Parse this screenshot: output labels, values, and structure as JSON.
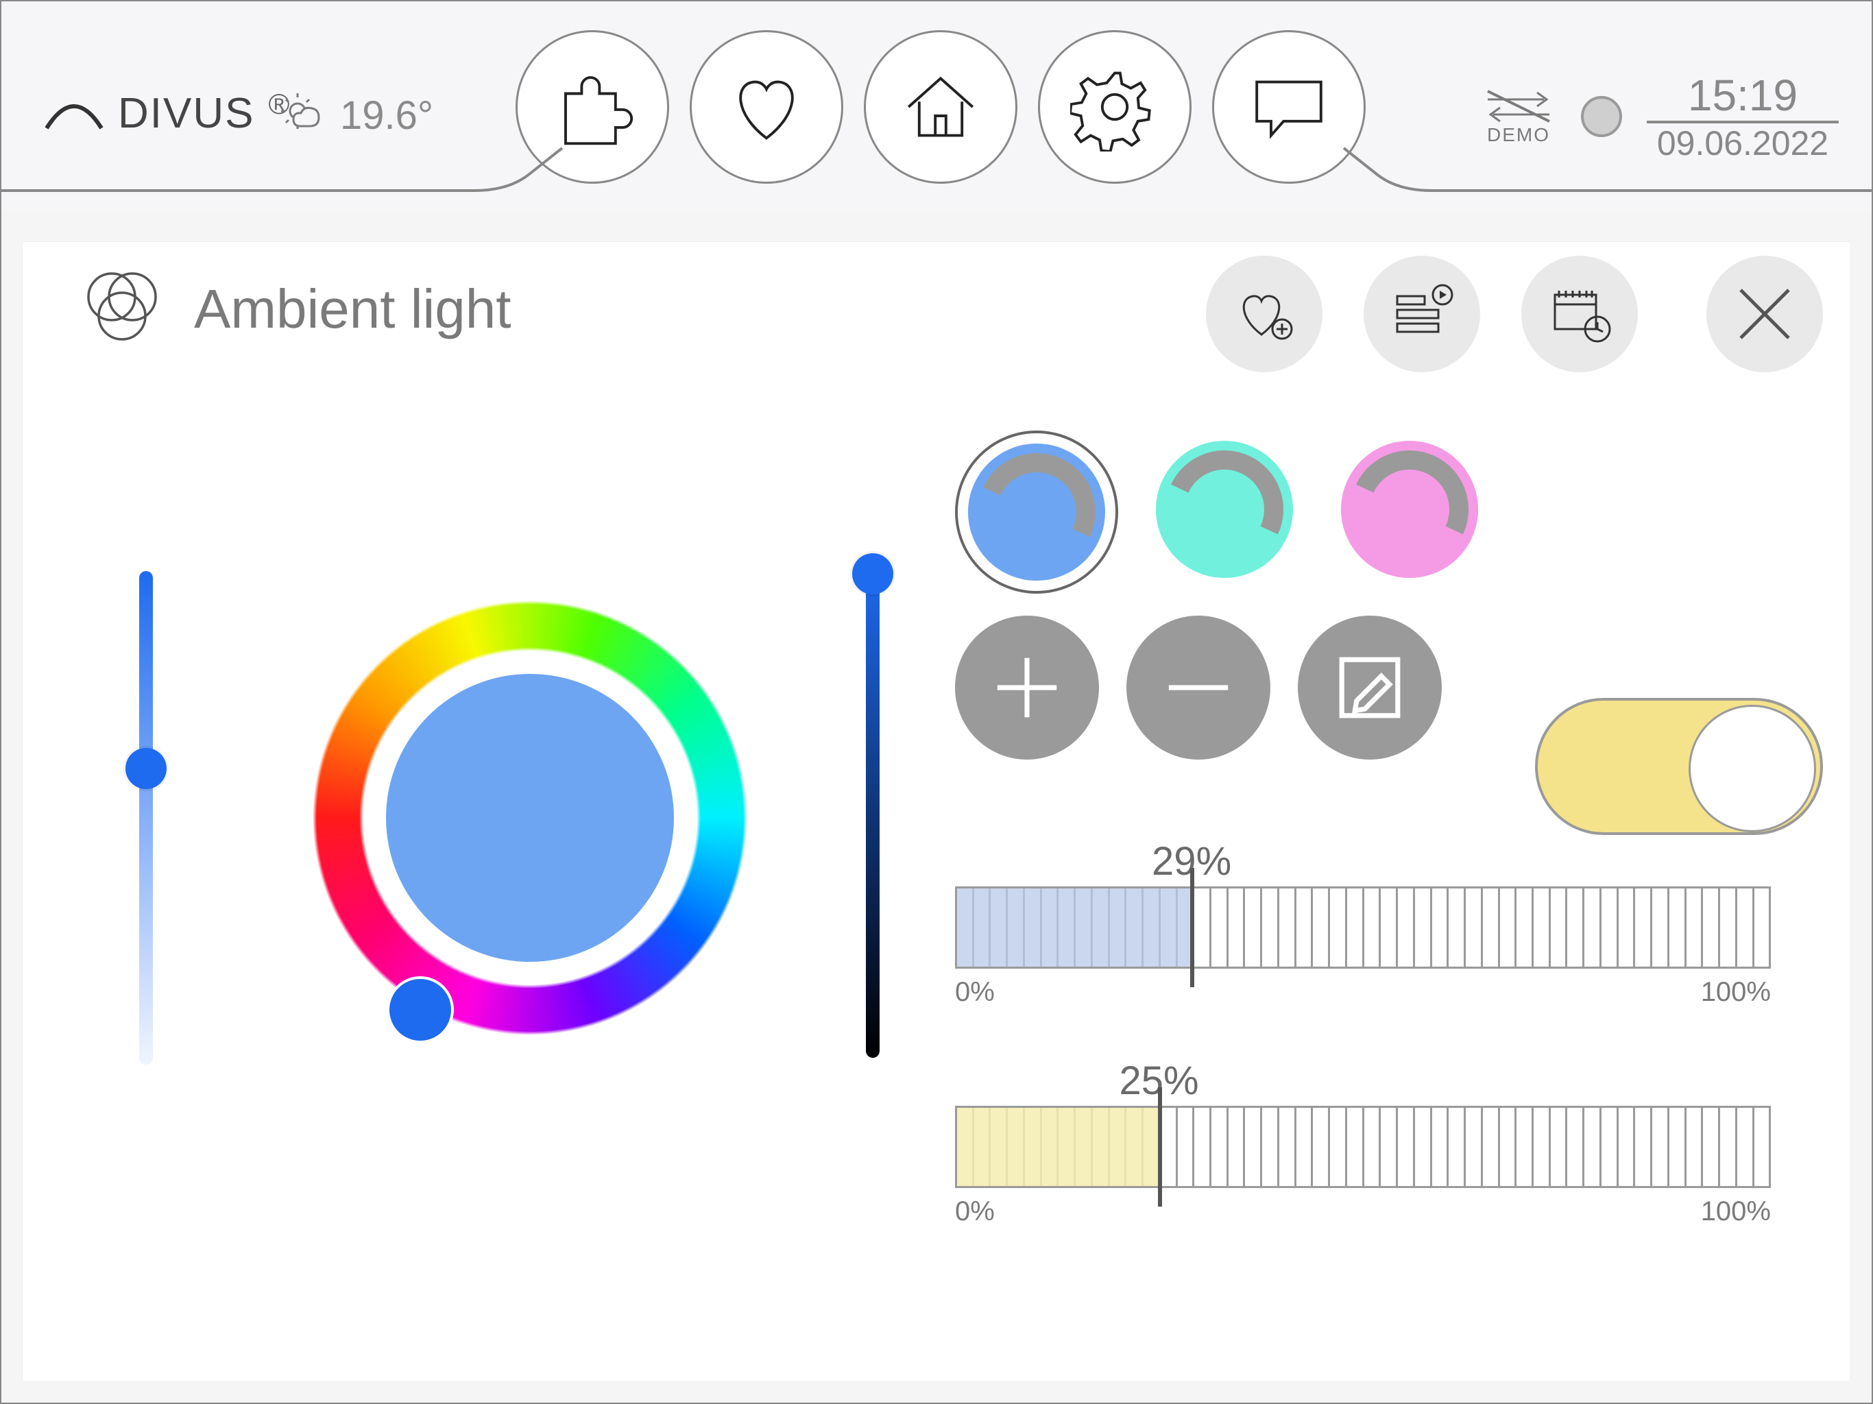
{
  "brand": "DIVUS",
  "weather": {
    "icon": "partly-cloudy",
    "temperature": "19.6°"
  },
  "sync_label": "DEMO",
  "clock": {
    "time": "15:19",
    "date": "09.06.2022"
  },
  "nav": {
    "items": [
      "puzzle",
      "heart",
      "home",
      "gear",
      "chat"
    ]
  },
  "card": {
    "title": "Ambient light",
    "icon": "rgb-venn",
    "actions": [
      "favorite-add",
      "playlist",
      "schedule"
    ],
    "close": "close"
  },
  "color": {
    "selected_hex": "#6ea5f2",
    "hue_angle": 225,
    "saturation_slider": 0.4,
    "value_slider": 0.02,
    "wheel_cursor": {
      "x_pct": 30,
      "y_pct": 85
    }
  },
  "presets": [
    {
      "color": "#6ea5f2",
      "selected": true,
      "name": "preset-blue"
    },
    {
      "color": "#70f0dd",
      "selected": false,
      "name": "preset-teal"
    },
    {
      "color": "#f59ae5",
      "selected": false,
      "name": "preset-pink"
    }
  ],
  "ops": [
    "plus",
    "minus",
    "edit"
  ],
  "toggle": {
    "state": "on",
    "on_color": "#f4e38b"
  },
  "bars": [
    {
      "value": 29,
      "min_label": "0%",
      "max_label": "100%",
      "fill_color": "#b9c9e8"
    },
    {
      "value": 25,
      "min_label": "0%",
      "max_label": "100%",
      "fill_color": "#f3edb0"
    }
  ]
}
